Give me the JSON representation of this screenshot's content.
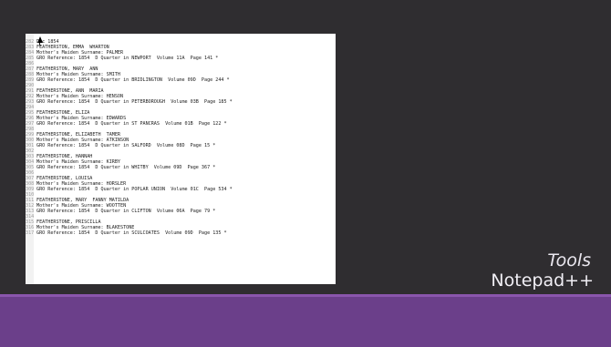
{
  "slide": {
    "title_italic": "Tools",
    "title_main": "Notepad++"
  },
  "editor_lines": [
    {
      "num": "282",
      "text": "Dec 1854"
    },
    {
      "num": "283",
      "text": "FEATHERSTON, EMMA  WHARTON"
    },
    {
      "num": "284",
      "text": "Mother's Maiden Surname: PALMER"
    },
    {
      "num": "285",
      "text": "GRO Reference: 1854  D Quarter in NEWPORT  Volume 11A  Page 141 *"
    },
    {
      "num": "286",
      "text": ""
    },
    {
      "num": "287",
      "text": "FEATHERSTON, MARY  ANN"
    },
    {
      "num": "288",
      "text": "Mother's Maiden Surname: SMITH"
    },
    {
      "num": "289",
      "text": "GRO Reference: 1854  D Quarter in BRIDLINGTON  Volume 09D  Page 244 *"
    },
    {
      "num": "290",
      "text": ""
    },
    {
      "num": "291",
      "text": "FEATHERSTONE, ANN  MARIA"
    },
    {
      "num": "292",
      "text": "Mother's Maiden Surname: HENSON"
    },
    {
      "num": "293",
      "text": "GRO Reference: 1854  D Quarter in PETERBOROUGH  Volume 03B  Page 185 *"
    },
    {
      "num": "294",
      "text": ""
    },
    {
      "num": "295",
      "text": "FEATHERSTONE, ELIZA"
    },
    {
      "num": "296",
      "text": "Mother's Maiden Surname: EDWARDS"
    },
    {
      "num": "297",
      "text": "GRO Reference: 1854  D Quarter in ST PANCRAS  Volume 01B  Page 122 *"
    },
    {
      "num": "298",
      "text": ""
    },
    {
      "num": "299",
      "text": "FEATHERSTONE, ELIZABETH  TAMER"
    },
    {
      "num": "300",
      "text": "Mother's Maiden Surname: ATKINSON"
    },
    {
      "num": "301",
      "text": "GRO Reference: 1854  D Quarter in SALFORD  Volume 08D  Page 15 *"
    },
    {
      "num": "302",
      "text": ""
    },
    {
      "num": "303",
      "text": "FEATHERSTONE, HANNAH"
    },
    {
      "num": "304",
      "text": "Mother's Maiden Surname: KIRBY"
    },
    {
      "num": "305",
      "text": "GRO Reference: 1854  D Quarter in WHITBY  Volume 09D  Page 367 *"
    },
    {
      "num": "306",
      "text": ""
    },
    {
      "num": "307",
      "text": "FEATHERSTONE, LOUISA"
    },
    {
      "num": "308",
      "text": "Mother's Maiden Surname: HORSLER"
    },
    {
      "num": "309",
      "text": "GRO Reference: 1854  D Quarter in POPLAR UNION  Volume 01C  Page 534 *"
    },
    {
      "num": "310",
      "text": ""
    },
    {
      "num": "311",
      "text": "FEATHERSTONE, MARY  FANNY MATILDA"
    },
    {
      "num": "312",
      "text": "Mother's Maiden Surname: WOOTTEN"
    },
    {
      "num": "313",
      "text": "GRO Reference: 1854  D Quarter in CLIFTON  Volume 06A  Page 79 *"
    },
    {
      "num": "314",
      "text": ""
    },
    {
      "num": "315",
      "text": "FEATHERSTONE, PRISCILLA"
    },
    {
      "num": "316",
      "text": "Mother's Maiden Surname: BLAKESTONE"
    },
    {
      "num": "317",
      "text": "GRO Reference: 1854  D Quarter in SCULCOATES  Volume 09D  Page 135 *"
    }
  ],
  "colors": {
    "background": "#2f2d30",
    "accent_band": "#6b3f8a",
    "accent_line": "#8a56ad"
  }
}
